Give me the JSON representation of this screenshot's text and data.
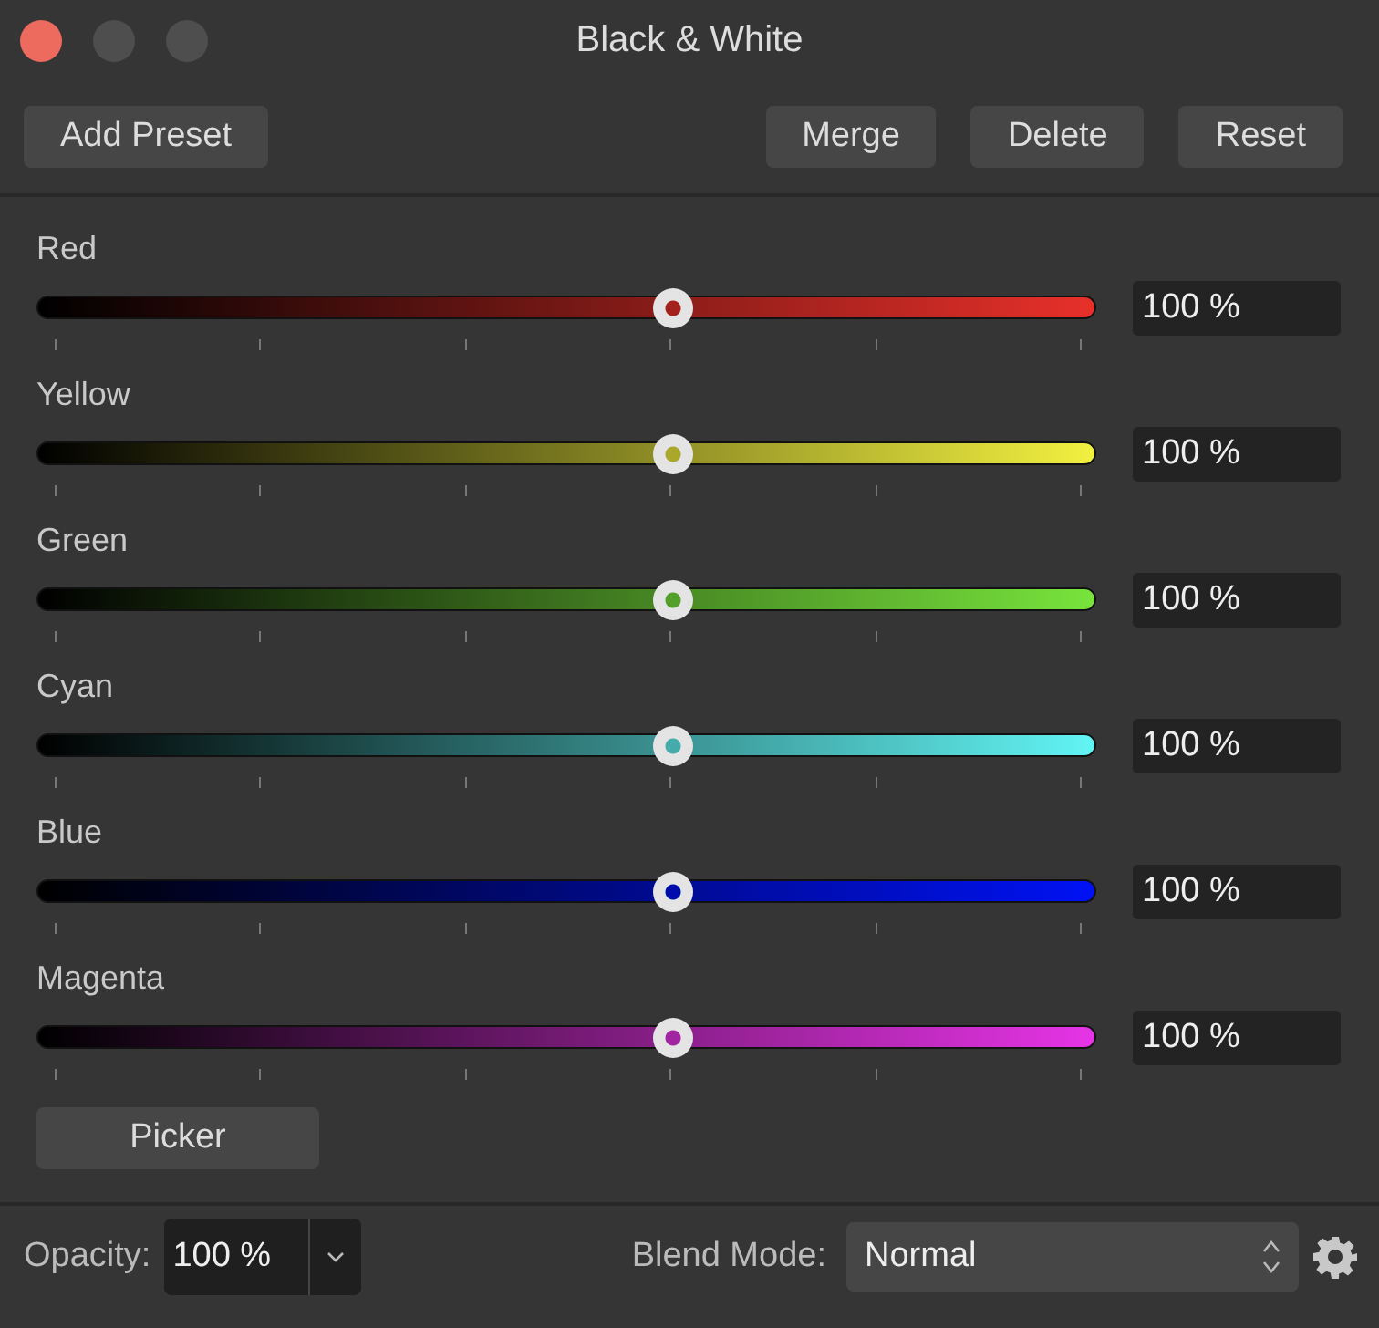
{
  "window": {
    "title": "Black & White"
  },
  "toolbar": {
    "left": [
      "Add Preset"
    ],
    "right": [
      "Merge",
      "Delete",
      "Reset"
    ]
  },
  "channels": [
    {
      "name": "Red",
      "color": "#e8302a",
      "level": 0.6,
      "reading": "100 %"
    },
    {
      "name": "Yellow",
      "color": "#f2f040",
      "level": 0.6,
      "reading": "100 %"
    },
    {
      "name": "Green",
      "color": "#78e43c",
      "level": 0.6,
      "reading": "100 %"
    },
    {
      "name": "Cyan",
      "color": "#62f4f4",
      "level": 0.6,
      "reading": "100 %"
    },
    {
      "name": "Blue",
      "color": "#0012f4",
      "level": 0.6,
      "reading": "100 %"
    },
    {
      "name": "Magenta",
      "color": "#e634e6",
      "level": 0.6,
      "reading": "100 %"
    }
  ],
  "picker_button": "Picker",
  "footer": {
    "opacity_label": "Opacity:",
    "opacity_value": "100 %",
    "blend_label": "Blend Mode:",
    "blend_value": "Normal"
  }
}
